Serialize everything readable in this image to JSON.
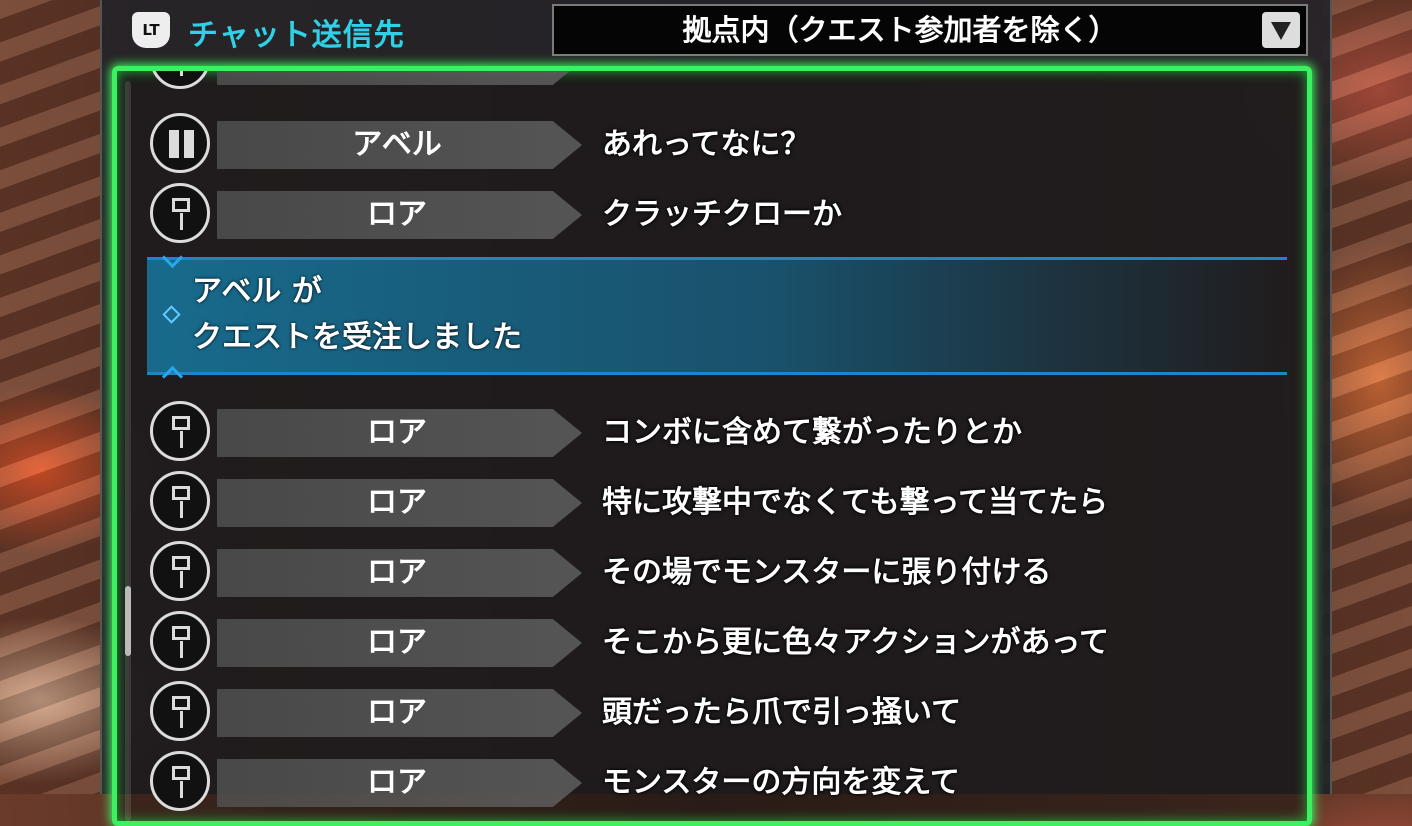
{
  "header": {
    "button_badge": "LT",
    "chat_target_label": "チャット送信先",
    "chat_target_value": "拠点内（クエスト参加者を除く）"
  },
  "chat": {
    "messages_top": [
      {
        "sender": "アベル",
        "icon": "dual-blades-icon",
        "text": "あれってなに？"
      },
      {
        "sender": "ロア",
        "icon": "hammer-icon",
        "text": "クラッチクローか"
      }
    ],
    "system_notice": {
      "line1": "アベル が",
      "line2": "クエストを受注しました"
    },
    "messages_bottom": [
      {
        "sender": "ロア",
        "icon": "hammer-icon",
        "text": "コンボに含めて繋がったりとか"
      },
      {
        "sender": "ロア",
        "icon": "hammer-icon",
        "text": "特に攻撃中でなくても撃って当てたら"
      },
      {
        "sender": "ロア",
        "icon": "hammer-icon",
        "text": "その場でモンスターに張り付ける"
      },
      {
        "sender": "ロア",
        "icon": "hammer-icon",
        "text": "そこから更に色々アクションがあって"
      },
      {
        "sender": "ロア",
        "icon": "hammer-icon",
        "text": "頭だったら爪で引っ掻いて"
      },
      {
        "sender": "ロア",
        "icon": "hammer-icon",
        "text": "モンスターの方向を変えて"
      }
    ]
  },
  "colors": {
    "frame_highlight": "#3df060",
    "label_cyan": "#2ed1e5",
    "notice_blue": "#1e86c8"
  }
}
